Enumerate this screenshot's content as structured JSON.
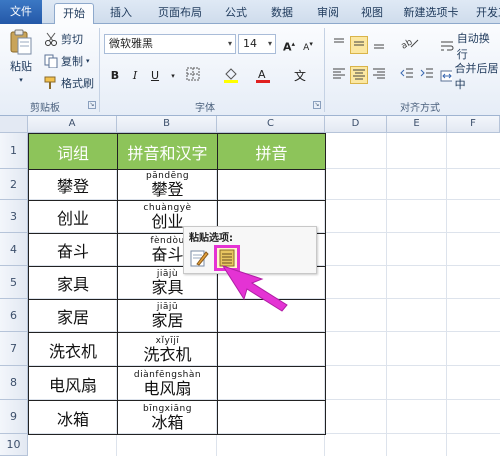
{
  "ribbon_tabs": [
    "文件",
    "开始",
    "插入",
    "页面布局",
    "公式",
    "数据",
    "审阅",
    "视图",
    "新建选项卡",
    "开发工具"
  ],
  "clipboard": {
    "paste": "粘贴",
    "cut": "剪切",
    "copy": "复制",
    "format_painter": "格式刷",
    "group": "剪贴板"
  },
  "font": {
    "name": "微软雅黑",
    "size": "14",
    "bold": "B",
    "italic": "I",
    "underline": "U",
    "wen": "文",
    "group": "字体"
  },
  "alignment": {
    "wrap": "自动换行",
    "merge": "合并后居中",
    "group": "对齐方式"
  },
  "columns": [
    "A",
    "B",
    "C",
    "D",
    "E",
    "F"
  ],
  "rows": [
    "1",
    "2",
    "3",
    "4",
    "5",
    "6",
    "7",
    "8",
    "9",
    "10"
  ],
  "headers": {
    "a": "词组",
    "b": "拼音和汉字",
    "c": "拼音"
  },
  "words": [
    {
      "word": "攀登",
      "pinyin": "pāndēng"
    },
    {
      "word": "创业",
      "pinyin": "chuàngyè"
    },
    {
      "word": "奋斗",
      "pinyin": "fèndòu"
    },
    {
      "word": "家具",
      "pinyin": "jiājù"
    },
    {
      "word": "家居",
      "pinyin": "jiājū"
    },
    {
      "word": "洗衣机",
      "pinyin": "xǐyījī"
    },
    {
      "word": "电风扇",
      "pinyin": "diànfēngshàn"
    },
    {
      "word": "冰箱",
      "pinyin": "bīngxiāng"
    }
  ],
  "paste_options": {
    "title": "粘贴选项:"
  },
  "colors": {
    "header_green": "#8dc45a",
    "highlight": "#e433d4"
  }
}
